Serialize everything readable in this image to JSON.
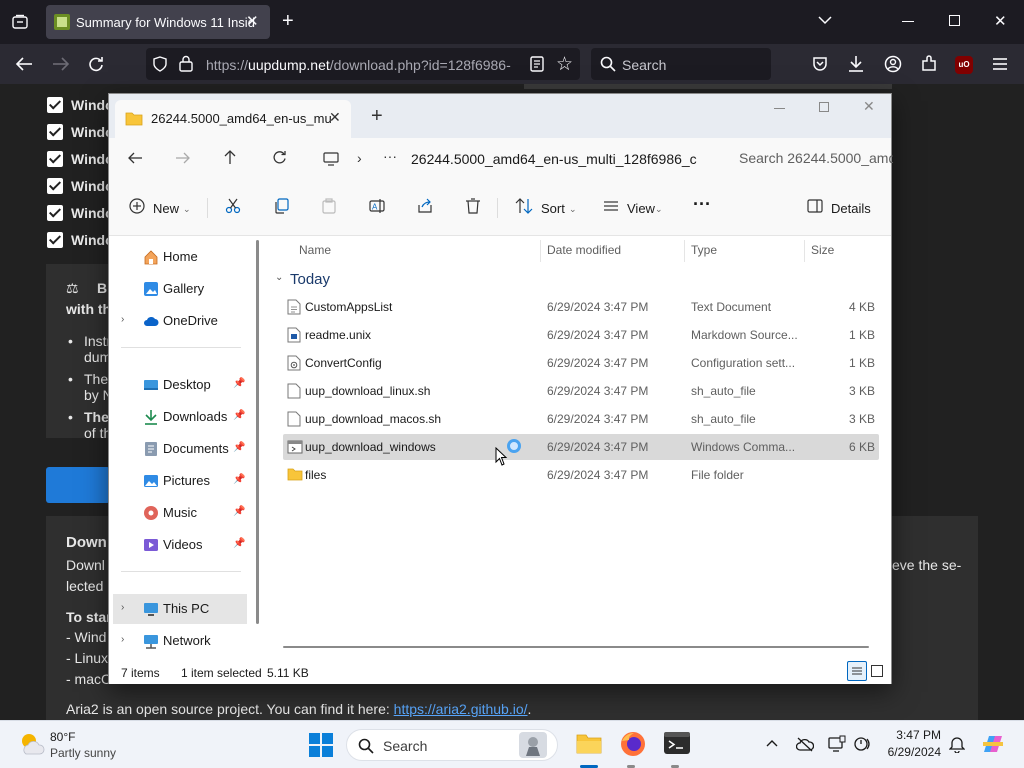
{
  "browser": {
    "tab_title": "Summary for Windows 11 Insid",
    "url_domain": "uupdump.net",
    "url_prefix": "https://",
    "url_rest": "/download.php?id=128f6986-",
    "search_placeholder": "Search",
    "ext_badge": "uO"
  },
  "page": {
    "checklist_prefix": [
      "Windo",
      "Windo",
      "Windo",
      "Windo",
      "Windo",
      "Windo"
    ],
    "info_heading_1": "B",
    "info_heading_2": "with th",
    "bullet_1a": "Instr",
    "bullet_1b": "dum",
    "bullet_2a": "The",
    "bullet_2b": "by N",
    "bullet_3a": "The",
    "bullet_3b": "of th",
    "down_heading": "Down",
    "down_text_1": "Downl",
    "down_text_2": "lected",
    "down_text_right": "eve the se-",
    "to_start": "To star",
    "item_win": "- Wind",
    "item_linux": "- Linux",
    "item_mac": "- macO",
    "aria_text": "Aria2 is an open source project. You can find it here: ",
    "aria_link": "https://aria2.github.io/",
    "aria_end": "."
  },
  "explorer": {
    "tab_title": "26244.5000_amd64_en-us_mu",
    "path": "26244.5000_amd64_en-us_multi_128f6986_c",
    "search": "Search 26244.5000_amd6",
    "commands": {
      "new": "New",
      "sort": "Sort",
      "view": "View",
      "details": "Details"
    },
    "nav": [
      {
        "label": "Home",
        "icon": "home-icon"
      },
      {
        "label": "Gallery",
        "icon": "gallery-icon"
      },
      {
        "label": "OneDrive",
        "icon": "cloud-icon"
      },
      {
        "label": "Desktop",
        "icon": "desktop-icon"
      },
      {
        "label": "Downloads",
        "icon": "download-icon"
      },
      {
        "label": "Documents",
        "icon": "documents-icon"
      },
      {
        "label": "Pictures",
        "icon": "pictures-icon"
      },
      {
        "label": "Music",
        "icon": "music-icon"
      },
      {
        "label": "Videos",
        "icon": "videos-icon"
      },
      {
        "label": "This PC",
        "icon": "computer-icon"
      },
      {
        "label": "Network",
        "icon": "network-icon"
      }
    ],
    "columns": {
      "name": "Name",
      "date": "Date modified",
      "type": "Type",
      "size": "Size"
    },
    "group": "Today",
    "files": [
      {
        "name": "CustomAppsList",
        "date": "6/29/2024 3:47 PM",
        "type": "Text Document",
        "size": "4 KB"
      },
      {
        "name": "readme.unix",
        "date": "6/29/2024 3:47 PM",
        "type": "Markdown Source...",
        "size": "1 KB"
      },
      {
        "name": "ConvertConfig",
        "date": "6/29/2024 3:47 PM",
        "type": "Configuration sett...",
        "size": "1 KB"
      },
      {
        "name": "uup_download_linux.sh",
        "date": "6/29/2024 3:47 PM",
        "type": "sh_auto_file",
        "size": "3 KB"
      },
      {
        "name": "uup_download_macos.sh",
        "date": "6/29/2024 3:47 PM",
        "type": "sh_auto_file",
        "size": "3 KB"
      },
      {
        "name": "uup_download_windows",
        "date": "6/29/2024 3:47 PM",
        "type": "Windows Comma...",
        "size": "6 KB"
      },
      {
        "name": "files",
        "date": "6/29/2024 3:47 PM",
        "type": "File folder",
        "size": ""
      }
    ],
    "status": {
      "items": "7 items",
      "selected": "1 item selected",
      "size": "5.11 KB"
    }
  },
  "taskbar": {
    "temp": "80°F",
    "weather": "Partly sunny",
    "search": "Search",
    "time": "3:47 PM",
    "date": "6/29/2024"
  },
  "colors": {
    "accent": "#0067c0",
    "selected_row": "#cce8ff",
    "folder": "#f8c53a"
  }
}
